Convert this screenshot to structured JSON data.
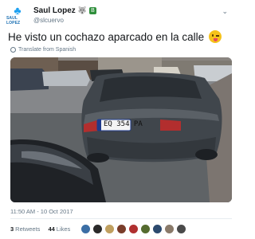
{
  "author": {
    "logo_text": "SAUL LOPEZ",
    "name": "Saul Lopez",
    "handle": "@slcuervo",
    "wolf_emoji": "🐺",
    "badge_symbol": "🅱"
  },
  "tweet": {
    "text": "He visto un cochazo aparcado en la calle",
    "emoji_icon": "winking-face-with-tongue-icon",
    "translate_label": "Translate from Spanish"
  },
  "photo": {
    "plate": "EQ 354 PA",
    "alt_subject": "grey-tesla-sedan"
  },
  "meta": {
    "timestamp": "11:50 AM - 10 Oct 2017"
  },
  "stats": {
    "retweets_count": "3",
    "retweets_label": "Retweets",
    "likes_count": "44",
    "likes_label": "Likes"
  },
  "likers": [
    {
      "color": "#3b6ea5",
      "name": "liker-avatar-1"
    },
    {
      "color": "#2a2a2a",
      "name": "liker-avatar-2"
    },
    {
      "color": "#c0a060",
      "name": "liker-avatar-3"
    },
    {
      "color": "#7a3d2a",
      "name": "liker-avatar-4"
    },
    {
      "color": "#b03030",
      "name": "liker-avatar-5"
    },
    {
      "color": "#556b2f",
      "name": "liker-avatar-6"
    },
    {
      "color": "#2c4a6e",
      "name": "liker-avatar-7"
    },
    {
      "color": "#8a7a6a",
      "name": "liker-avatar-8"
    },
    {
      "color": "#4a4a4a",
      "name": "liker-avatar-9"
    }
  ],
  "colors": {
    "accent": "#1da1f2",
    "muted": "#657786",
    "text": "#14171a"
  }
}
